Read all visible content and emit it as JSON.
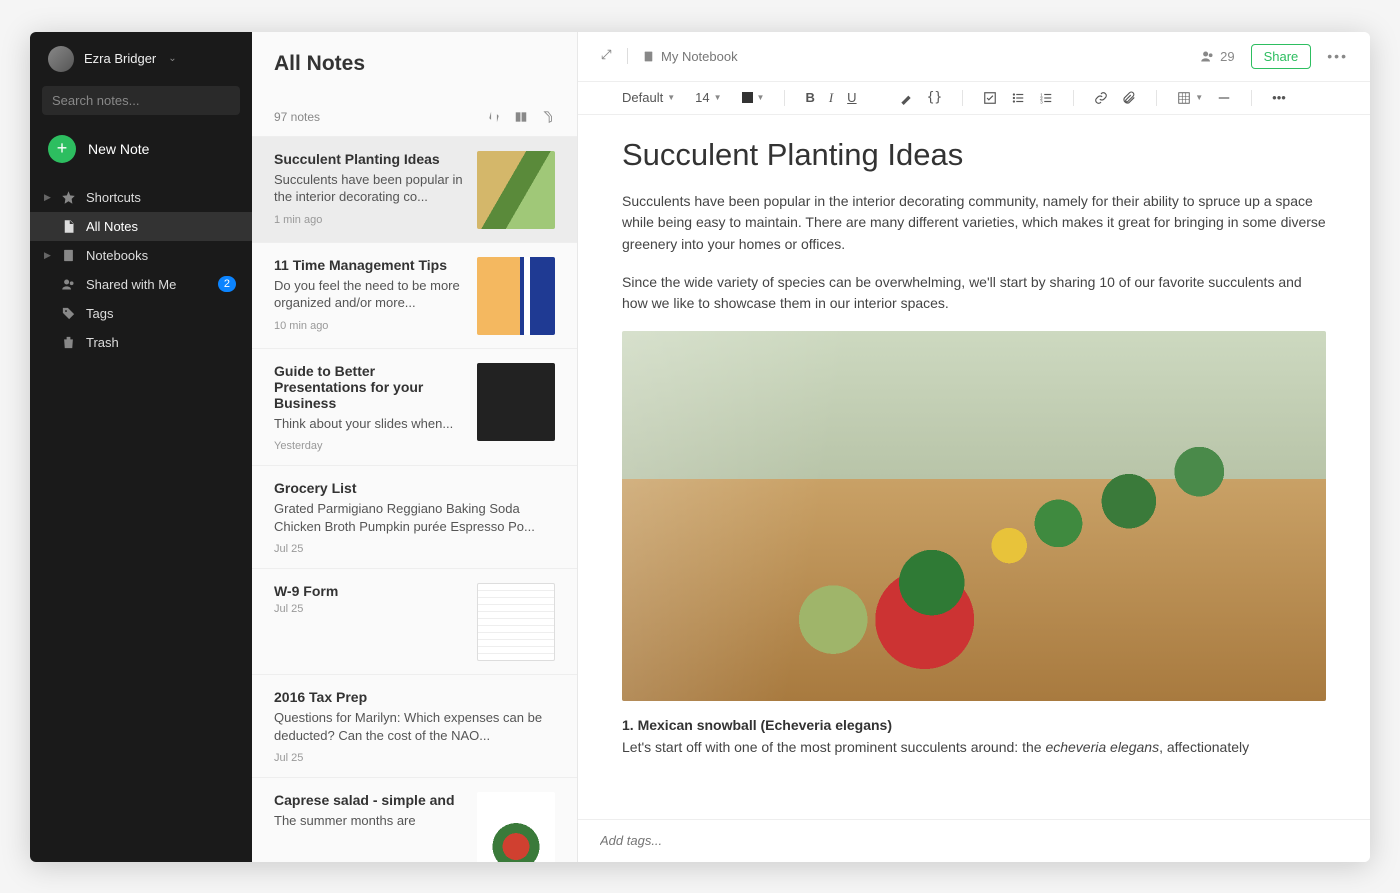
{
  "sidebar": {
    "username": "Ezra Bridger",
    "search_placeholder": "Search notes...",
    "new_note_label": "New Note",
    "nav": {
      "shortcuts": "Shortcuts",
      "all_notes": "All Notes",
      "notebooks": "Notebooks",
      "shared": "Shared with Me",
      "shared_badge": "2",
      "tags": "Tags",
      "trash": "Trash"
    }
  },
  "notelist": {
    "title": "All Notes",
    "count": "97 notes",
    "items": [
      {
        "title": "Succulent Planting Ideas",
        "snippet": "Succulents have been popular in the interior decorating co...",
        "date": "1 min ago",
        "thumb": "succulents"
      },
      {
        "title": "11 Time Management Tips",
        "snippet": "Do you feel the need to be more organized and/or more...",
        "date": "10 min ago",
        "thumb": "time"
      },
      {
        "title": "Guide to Better Presentations for your Business",
        "snippet": "Think about your slides when...",
        "date": "Yesterday",
        "thumb": "presentation"
      },
      {
        "title": "Grocery List",
        "snippet": "Grated Parmigiano Reggiano Baking Soda Chicken Broth Pumpkin purée Espresso Po...",
        "date": "Jul 25",
        "thumb": ""
      },
      {
        "title": "W-9 Form",
        "snippet": "",
        "date": "Jul 25",
        "thumb": "form"
      },
      {
        "title": "2016 Tax Prep",
        "snippet": "Questions for Marilyn: Which expenses can be deducted? Can the cost of the NAO...",
        "date": "Jul 25",
        "thumb": ""
      },
      {
        "title": "Caprese salad - simple and",
        "snippet": "The summer months are",
        "date": "",
        "thumb": "salad"
      }
    ]
  },
  "editor": {
    "notebook": "My Notebook",
    "share_count": "29",
    "share_label": "Share",
    "font_family": "Default",
    "font_size": "14",
    "doc_title": "Succulent Planting Ideas",
    "para1": "Succulents have been popular in the interior decorating community, namely for their ability to spruce up a space while being easy to maintain. There are many different varieties, which makes it great for bringing in some diverse greenery into your homes or offices.",
    "para2": "Since the wide variety of species can be overwhelming, we'll start by sharing 10 of our favorite succulents and how we like to showcase them in our interior spaces.",
    "section1_heading": "1. Mexican snowball (Echeveria elegans)",
    "section1_body_a": "Let's start off with one of the most prominent succulents around: the ",
    "section1_body_em": "echeveria elegans",
    "section1_body_b": ", affectionately",
    "tag_placeholder": "Add tags..."
  }
}
